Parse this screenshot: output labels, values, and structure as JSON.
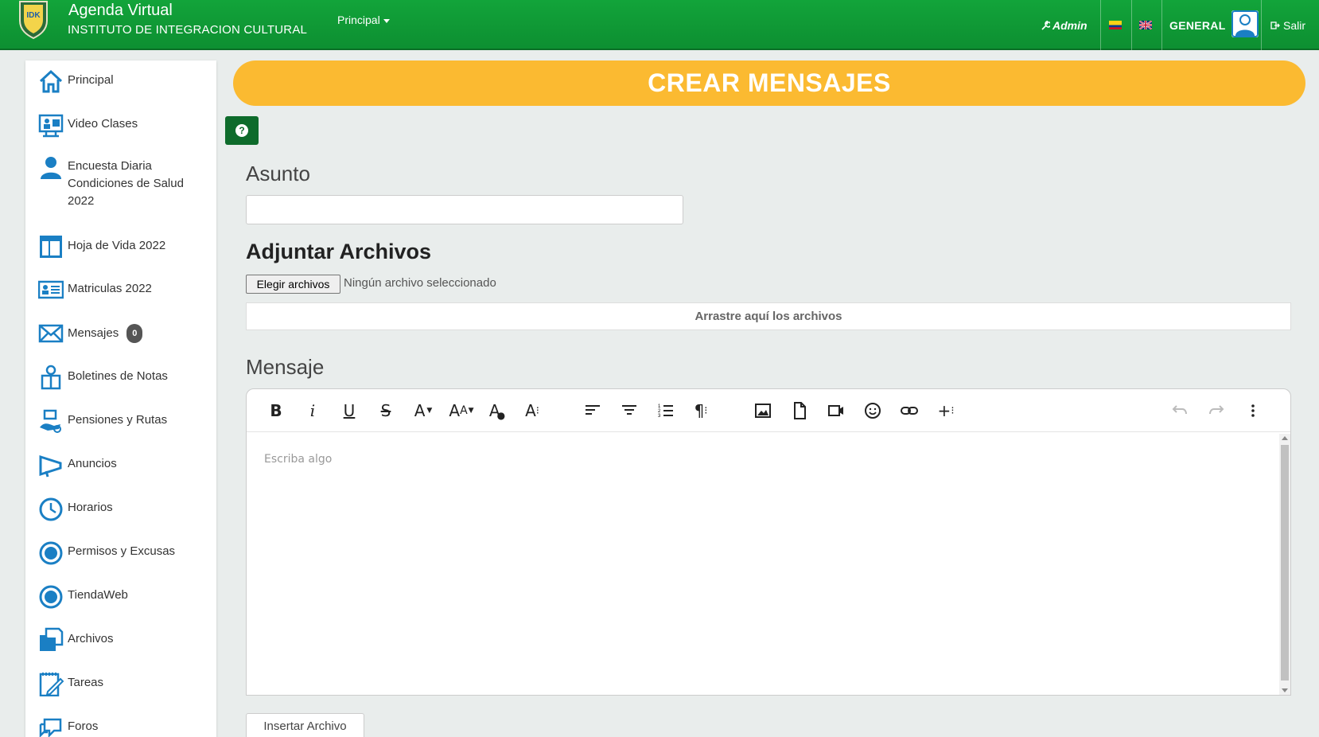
{
  "header": {
    "app_title": "Agenda Virtual",
    "institution": "INSTITUTO DE INTEGRACION CULTURAL",
    "logo_text": "IDK",
    "nav_principal": "Principal",
    "admin_label": "Admin",
    "user_label": "GENERAL",
    "logout_label": "Salir"
  },
  "sidebar": {
    "items": [
      {
        "label": "Principal",
        "icon": "home-icon"
      },
      {
        "label": "Video Clases",
        "icon": "video-class-icon"
      },
      {
        "label": "Encuesta Diaria Condiciones de Salud 2022",
        "icon": "person-icon"
      },
      {
        "label": "Hoja de Vida 2022",
        "icon": "layout-icon"
      },
      {
        "label": "Matriculas 2022",
        "icon": "id-card-icon"
      },
      {
        "label": "Mensajes",
        "icon": "envelope-icon",
        "badge": "0"
      },
      {
        "label": "Boletines de Notas",
        "icon": "report-icon"
      },
      {
        "label": "Pensiones y Rutas",
        "icon": "payment-icon"
      },
      {
        "label": "Anuncios",
        "icon": "megaphone-icon"
      },
      {
        "label": "Horarios",
        "icon": "clock-icon"
      },
      {
        "label": "Permisos y Excusas",
        "icon": "circle-dot-icon"
      },
      {
        "label": "TiendaWeb",
        "icon": "circle-dot-icon"
      },
      {
        "label": "Archivos",
        "icon": "folders-icon"
      },
      {
        "label": "Tareas",
        "icon": "task-icon"
      },
      {
        "label": "Foros",
        "icon": "chat-icon"
      }
    ]
  },
  "main": {
    "banner_title": "CREAR MENSAJES",
    "help_label": "?",
    "subject_label": "Asunto",
    "subject_value": "",
    "attach_label": "Adjuntar Archivos",
    "choose_files_label": "Elegir archivos",
    "no_file_label": "Ningún archivo seleccionado",
    "dropzone_label": "Arrastre aquí los archivos",
    "message_label": "Mensaje",
    "editor_placeholder": "Escriba algo",
    "insert_file_label": "Insertar Archivo"
  },
  "colors": {
    "header_green": "#12a43a",
    "banner_yellow": "#fbba31",
    "icon_blue": "#1a7fc4",
    "help_button_green": "#0e6b2b"
  }
}
